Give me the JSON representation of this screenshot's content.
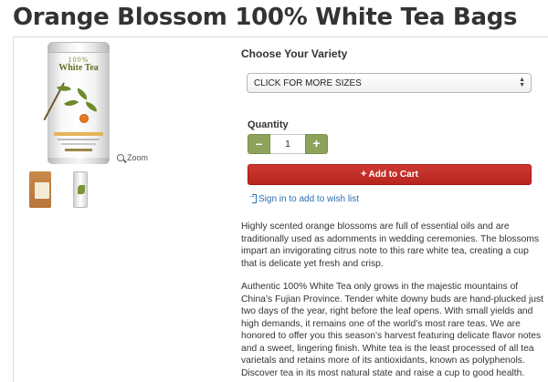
{
  "page": {
    "title": "Orange Blossom 100% White Tea Bags"
  },
  "product_image": {
    "tin_brand_top": "100%",
    "tin_brand_big": "White Tea",
    "zoom_label": "Zoom",
    "thumbnails": [
      {
        "name": "bag-thumbnail"
      },
      {
        "name": "tin-thumbnail"
      }
    ]
  },
  "variety": {
    "heading": "Choose Your Variety",
    "selected": "CLICK FOR MORE SIZES"
  },
  "quantity": {
    "label": "Quantity",
    "value": "1",
    "minus": "–",
    "plus": "+"
  },
  "cart": {
    "plus_glyph": "+",
    "label": "Add to Cart"
  },
  "wishlist": {
    "label": "Sign in to add to wish list"
  },
  "description": {
    "paragraph_1": "Highly scented orange blossoms are full of essential oils and are traditionally used as adornments in wedding ceremonies. The blossoms impart an invigorating citrus note to this rare white tea, creating a cup that is delicate yet fresh and crisp.",
    "paragraph_2": "Authentic 100% White Tea only grows in the majestic mountains of China’s Fujian Province. Tender white downy buds are hand-plucked just two days of the year, right before the leaf opens. With small yields and high demands, it remains one of the world’s most rare teas. We are honored to offer you this season’s harvest featuring delicate flavor notes and a sweet, lingering finish. White tea is the least processed of all tea varietals and retains more of its antioxidants, known as polyphenols. Discover tea in its most natural state and raise a cup to good health."
  },
  "colors": {
    "qty_button": "#8ba35a",
    "add_to_cart": "#b8241e",
    "link": "#2a6fb6"
  }
}
